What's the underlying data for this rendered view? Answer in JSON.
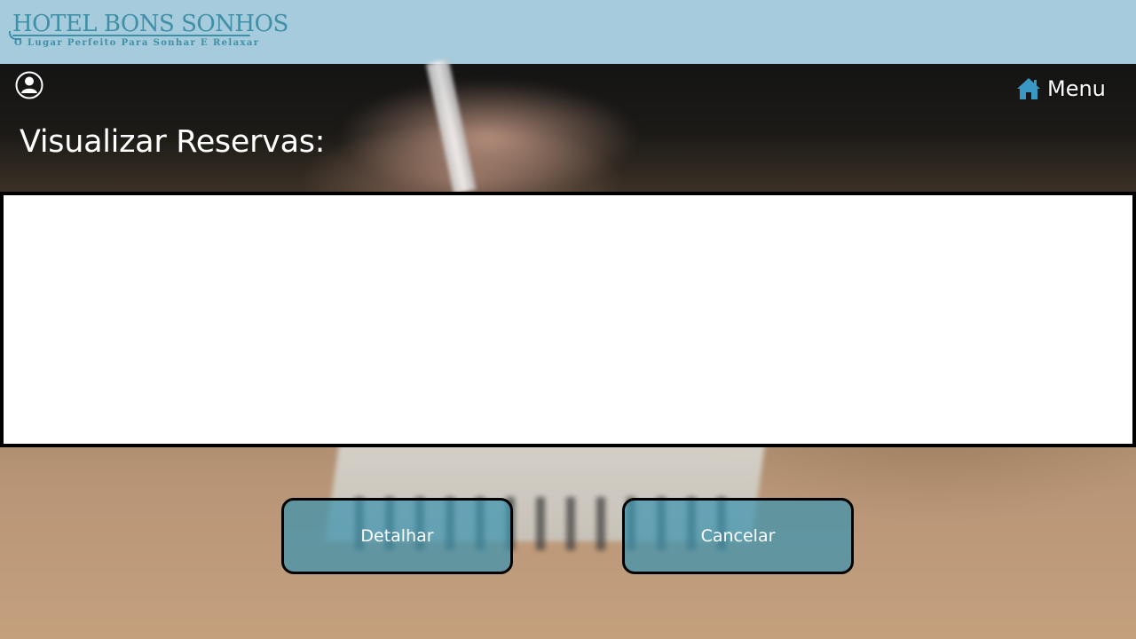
{
  "header": {
    "logo_title": "HOTEL BONS SONHOS",
    "logo_subtitle": "O Lugar Perfeito Para Sonhar E Relaxar"
  },
  "topbar": {
    "user_icon": "user-icon",
    "menu_icon": "home-icon",
    "menu_label": "Menu"
  },
  "main": {
    "title": "Visualizar Reservas:"
  },
  "actions": {
    "detalhar_label": "Detalhar",
    "cancelar_label": "Cancelar"
  },
  "colors": {
    "header_bg": "#a5cbdc",
    "brand": "#3f8fa6",
    "button_bg": "#3d94b0",
    "home_icon": "#3a98c4"
  }
}
